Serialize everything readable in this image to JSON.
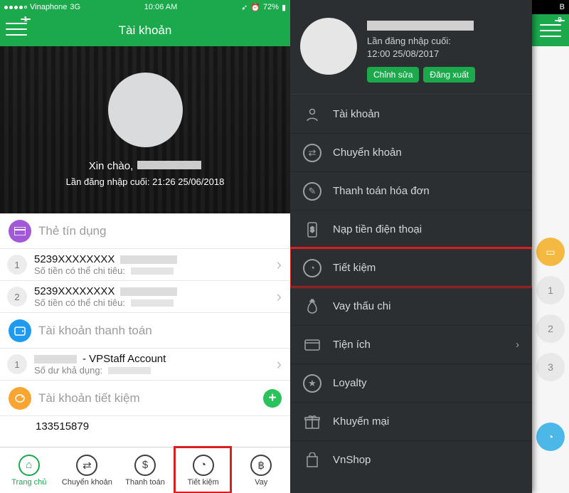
{
  "left": {
    "status": {
      "carrier": "Vinaphone",
      "network": "3G",
      "time": "10:06 AM",
      "battery": "72%"
    },
    "nav": {
      "menu_badge": "1",
      "title": "Tài khoản"
    },
    "hero": {
      "greeting_prefix": "Xin chào,",
      "last_login_label": "Lần đăng nhập cuối:",
      "last_login_value": "21:26 25/06/2018"
    },
    "sections": {
      "credit": {
        "title": "Thẻ tín dụng"
      },
      "payment": {
        "title": "Tài khoản thanh toán"
      },
      "savings": {
        "title": "Tài khoản tiết kiệm"
      }
    },
    "accounts": {
      "credit": [
        {
          "idx": "1",
          "mask": "5239XXXXXXXX",
          "sub": "Số tiền có thể chi tiêu:"
        },
        {
          "idx": "2",
          "mask": "5239XXXXXXXX",
          "sub": "Số tiền có thể chi tiêu:"
        }
      ],
      "payment": [
        {
          "idx": "1",
          "name_suffix": "- VPStaff Account",
          "sub": "Số dư khả dụng:"
        }
      ],
      "savings": [
        {
          "mask": "133515879"
        }
      ]
    },
    "tabs": [
      {
        "label": "Trang chủ"
      },
      {
        "label": "Chuyển khoản"
      },
      {
        "label": "Thanh toán"
      },
      {
        "label": "Tiết kiệm"
      },
      {
        "label": "Vay"
      }
    ]
  },
  "right": {
    "status": {
      "right_text": "B"
    },
    "nav_badge": "9",
    "drawer": {
      "last_login_label": "Lần đăng nhập cuối:",
      "last_login_value": "12:00 25/08/2017",
      "edit_btn": "Chỉnh sửa",
      "logout_btn": "Đăng xuất"
    },
    "menu": [
      {
        "label": "Tài khoản"
      },
      {
        "label": "Chuyển khoản"
      },
      {
        "label": "Thanh toán hóa đơn"
      },
      {
        "label": "Nạp tiền điện thoại"
      },
      {
        "label": "Tiết kiệm"
      },
      {
        "label": "Vay thấu chi"
      },
      {
        "label": "Tiện ích"
      },
      {
        "label": "Loyalty"
      },
      {
        "label": "Khuyến mại"
      },
      {
        "label": "VnShop"
      }
    ],
    "peek": [
      {
        "idx": "1"
      },
      {
        "idx": "2"
      },
      {
        "idx": "3"
      }
    ]
  }
}
